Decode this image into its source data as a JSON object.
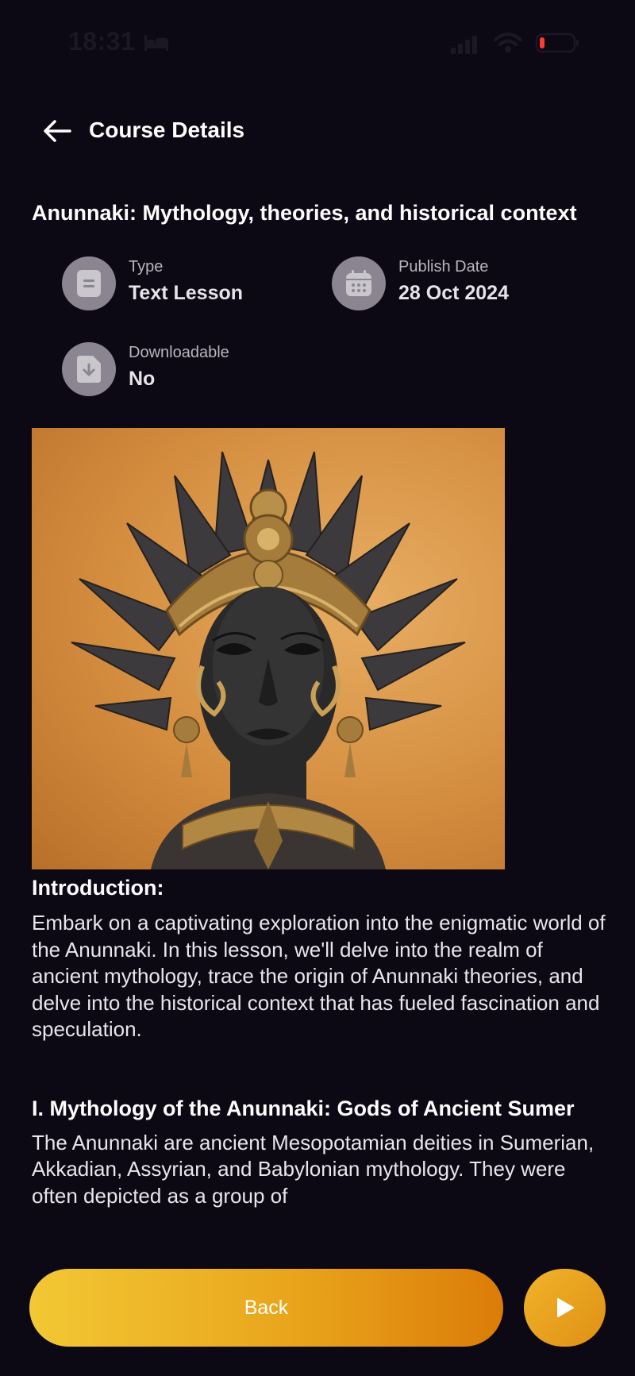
{
  "status_bar": {
    "time": "18:31",
    "icons": [
      "bed-icon",
      "signal-icon",
      "wifi-icon",
      "battery-icon"
    ],
    "battery_color": "#ff3b30"
  },
  "header": {
    "title": "Course Details",
    "back_icon": "arrow-left-icon"
  },
  "course": {
    "title": "Anunnaki: Mythology, theories, and historical context",
    "meta": [
      {
        "icon": "document-icon",
        "label": "Type",
        "value": "Text Lesson"
      },
      {
        "icon": "calendar-icon",
        "label": "Publish Date",
        "value": "28 Oct 2024"
      },
      {
        "icon": "download-file-icon",
        "label": "Downloadable",
        "value": "No"
      }
    ],
    "image": "sculpture-portrait-image"
  },
  "content": {
    "intro_heading": "Introduction:",
    "intro_text": "Embark on a captivating exploration into the enigmatic world of the Anunnaki. In this lesson, we'll delve into the realm of ancient mythology, trace the origin of Anunnaki theories, and delve into the historical context that has fueled fascination and speculation.",
    "section_heading": "I. Mythology of the Anunnaki: Gods of Ancient Sumer",
    "section_text": "The Anunnaki are ancient Mesopotamian deities in Sumerian, Akkadian, Assyrian, and Babylonian mythology. They were often depicted as a group of"
  },
  "actions": {
    "back_label": "Back",
    "play_icon": "play-icon"
  },
  "colors": {
    "background": "#0c0814",
    "accent_start": "#f2c834",
    "accent_end": "#db7c08",
    "icon_circle": "#8a8590"
  }
}
